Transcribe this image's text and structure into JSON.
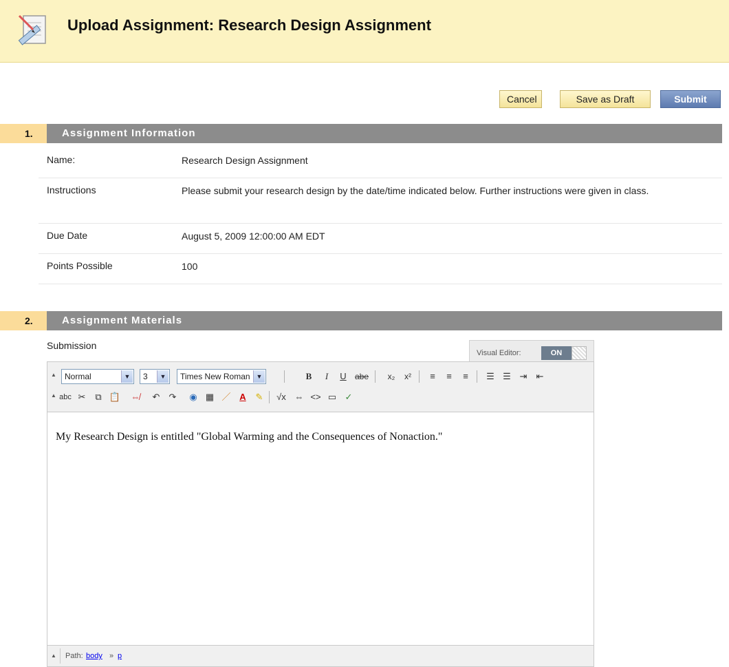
{
  "header": {
    "title": "Upload Assignment: Research Design Assignment",
    "icon": "assignment-ruler-icon"
  },
  "actions": {
    "cancel": "Cancel",
    "save_draft": "Save as Draft",
    "submit": "Submit"
  },
  "section1": {
    "number": "1.",
    "title": "Assignment Information",
    "rows": [
      {
        "label": "Name:",
        "value": "Research Design Assignment"
      },
      {
        "label": "Instructions",
        "value": "Please submit your research design by the date/time indicated below. Further instructions were given in class."
      },
      {
        "label": "Due Date",
        "value": "August 5, 2009 12:00:00 AM EDT"
      },
      {
        "label": "Points Possible",
        "value": "100"
      }
    ]
  },
  "section2": {
    "number": "2.",
    "title": "Assignment Materials",
    "submission_label": "Submission"
  },
  "editor": {
    "visual_editor_label": "Visual Editor:",
    "visual_editor_state": "ON",
    "style_select": "Normal",
    "size_select": "3",
    "font_select": "Times New Roman",
    "content": "My Research Design is entitled \"Global Warming and the Consequences of Nonaction.\"",
    "path_label": "Path:",
    "path": [
      "body",
      "p"
    ],
    "path_separator": "»",
    "strike_label": "abe",
    "spell_label": "abc"
  },
  "colors": {
    "header_bg": "#fcf3c2",
    "section_bar": "#8c8c8c",
    "section_number_bg": "#fbdc9a",
    "submit_bg": "#5d7bb0"
  }
}
